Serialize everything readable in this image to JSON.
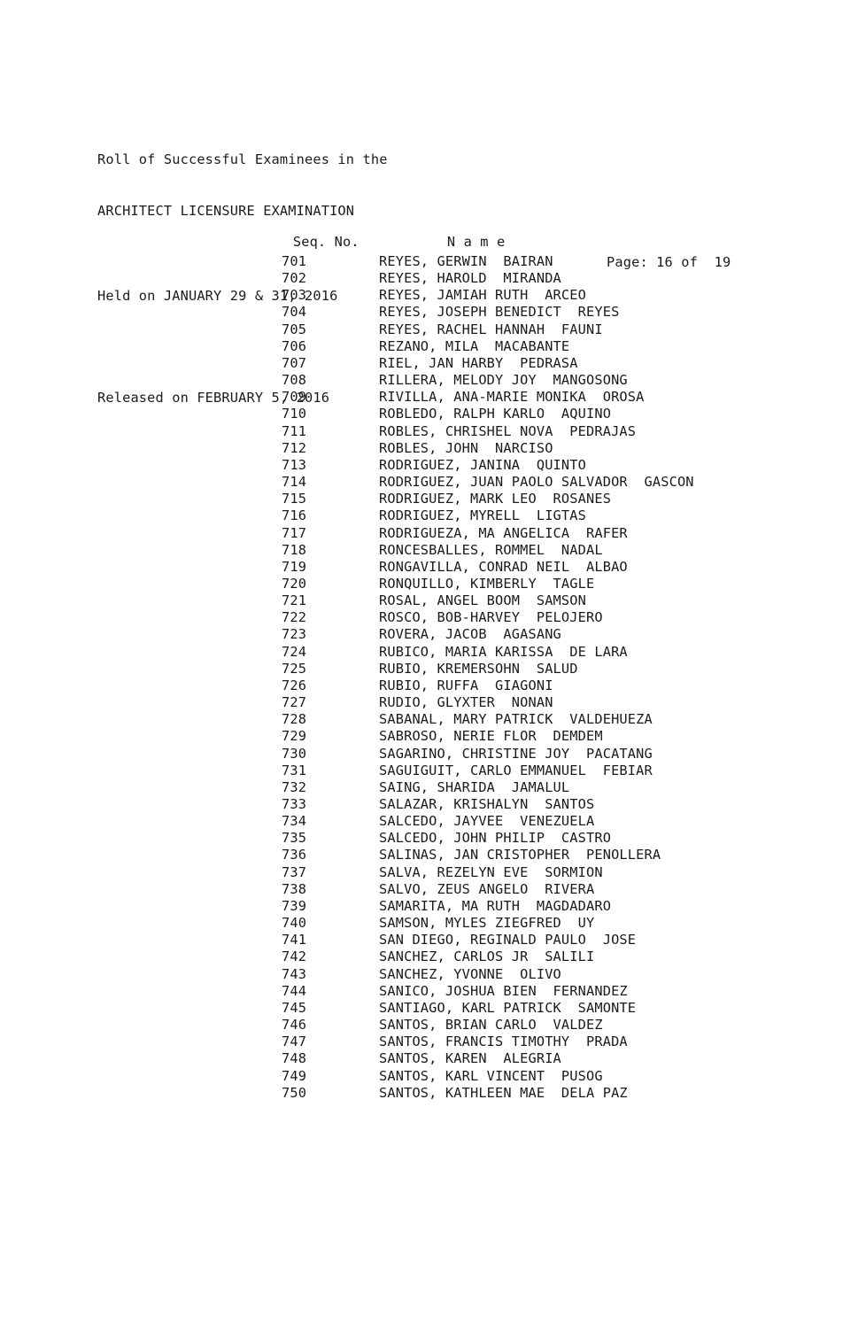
{
  "document": {
    "header_lines": [
      "Roll of Successful Examinees in the",
      "ARCHITECT LICENSURE EXAMINATION"
    ],
    "held_on": "Held on JANUARY 29 & 31, 2016",
    "released_on": "Released on FEBRUARY 5, 2016",
    "page_indicator": "Page: 16 of  19"
  },
  "columns": {
    "seq_no": "Seq. No.",
    "name": "N a m e"
  },
  "rows": [
    {
      "seq": "701",
      "name": "REYES, GERWIN  BAIRAN"
    },
    {
      "seq": "702",
      "name": "REYES, HAROLD  MIRANDA"
    },
    {
      "seq": "703",
      "name": "REYES, JAMIAH RUTH  ARCEO"
    },
    {
      "seq": "704",
      "name": "REYES, JOSEPH BENEDICT  REYES"
    },
    {
      "seq": "705",
      "name": "REYES, RACHEL HANNAH  FAUNI"
    },
    {
      "seq": "706",
      "name": "REZANO, MILA  MACABANTE"
    },
    {
      "seq": "707",
      "name": "RIEL, JAN HARBY  PEDRASA"
    },
    {
      "seq": "708",
      "name": "RILLERA, MELODY JOY  MANGOSONG"
    },
    {
      "seq": "709",
      "name": "RIVILLA, ANA-MARIE MONIKA  OROSA"
    },
    {
      "seq": "710",
      "name": "ROBLEDO, RALPH KARLO  AQUINO"
    },
    {
      "seq": "711",
      "name": "ROBLES, CHRISHEL NOVA  PEDRAJAS"
    },
    {
      "seq": "712",
      "name": "ROBLES, JOHN  NARCISO"
    },
    {
      "seq": "713",
      "name": "RODRIGUEZ, JANINA  QUINTO"
    },
    {
      "seq": "714",
      "name": "RODRIGUEZ, JUAN PAOLO SALVADOR  GASCON"
    },
    {
      "seq": "715",
      "name": "RODRIGUEZ, MARK LEO  ROSANES"
    },
    {
      "seq": "716",
      "name": "RODRIGUEZ, MYRELL  LIGTAS"
    },
    {
      "seq": "717",
      "name": "RODRIGUEZA, MA ANGELICA  RAFER"
    },
    {
      "seq": "718",
      "name": "RONCESBALLES, ROMMEL  NADAL"
    },
    {
      "seq": "719",
      "name": "RONGAVILLA, CONRAD NEIL  ALBAO"
    },
    {
      "seq": "720",
      "name": "RONQUILLO, KIMBERLY  TAGLE"
    },
    {
      "seq": "721",
      "name": "ROSAL, ANGEL BOOM  SAMSON"
    },
    {
      "seq": "722",
      "name": "ROSCO, BOB-HARVEY  PELOJERO"
    },
    {
      "seq": "723",
      "name": "ROVERA, JACOB  AGASANG"
    },
    {
      "seq": "724",
      "name": "RUBICO, MARIA KARISSA  DE LARA"
    },
    {
      "seq": "725",
      "name": "RUBIO, KREMERSOHN  SALUD"
    },
    {
      "seq": "726",
      "name": "RUBIO, RUFFA  GIAGONI"
    },
    {
      "seq": "727",
      "name": "RUDIO, GLYXTER  NONAN"
    },
    {
      "seq": "728",
      "name": "SABANAL, MARY PATRICK  VALDEHUEZA"
    },
    {
      "seq": "729",
      "name": "SABROSO, NERIE FLOR  DEMDEM"
    },
    {
      "seq": "730",
      "name": "SAGARINO, CHRISTINE JOY  PACATANG"
    },
    {
      "seq": "731",
      "name": "SAGUIGUIT, CARLO EMMANUEL  FEBIAR"
    },
    {
      "seq": "732",
      "name": "SAING, SHARIDA  JAMALUL"
    },
    {
      "seq": "733",
      "name": "SALAZAR, KRISHALYN  SANTOS"
    },
    {
      "seq": "734",
      "name": "SALCEDO, JAYVEE  VENEZUELA"
    },
    {
      "seq": "735",
      "name": "SALCEDO, JOHN PHILIP  CASTRO"
    },
    {
      "seq": "736",
      "name": "SALINAS, JAN CRISTOPHER  PENOLLERA"
    },
    {
      "seq": "737",
      "name": "SALVA, REZELYN EVE  SORMION"
    },
    {
      "seq": "738",
      "name": "SALVO, ZEUS ANGELO  RIVERA"
    },
    {
      "seq": "739",
      "name": "SAMARITA, MA RUTH  MAGDADARO"
    },
    {
      "seq": "740",
      "name": "SAMSON, MYLES ZIEGFRED  UY"
    },
    {
      "seq": "741",
      "name": "SAN DIEGO, REGINALD PAULO  JOSE"
    },
    {
      "seq": "742",
      "name": "SANCHEZ, CARLOS JR  SALILI"
    },
    {
      "seq": "743",
      "name": "SANCHEZ, YVONNE  OLIVO"
    },
    {
      "seq": "744",
      "name": "SANICO, JOSHUA BIEN  FERNANDEZ"
    },
    {
      "seq": "745",
      "name": "SANTIAGO, KARL PATRICK  SAMONTE"
    },
    {
      "seq": "746",
      "name": "SANTOS, BRIAN CARLO  VALDEZ"
    },
    {
      "seq": "747",
      "name": "SANTOS, FRANCIS TIMOTHY  PRADA"
    },
    {
      "seq": "748",
      "name": "SANTOS, KAREN  ALEGRIA"
    },
    {
      "seq": "749",
      "name": "SANTOS, KARL VINCENT  PUSOG"
    },
    {
      "seq": "750",
      "name": "SANTOS, KATHLEEN MAE  DELA PAZ"
    }
  ]
}
